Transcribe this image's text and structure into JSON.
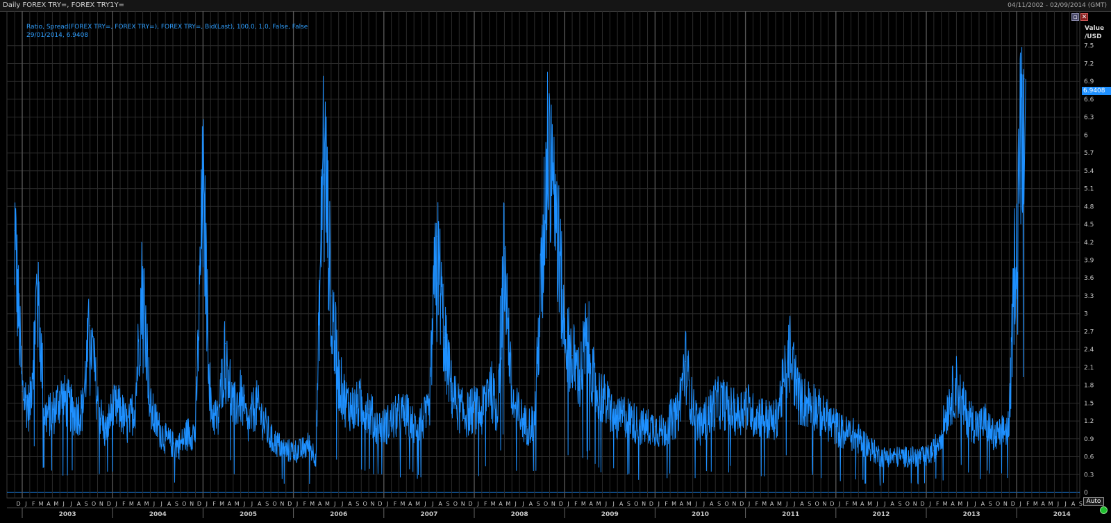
{
  "header": {
    "title": "Daily FOREX TRY=, FOREX TRY1Y=",
    "date_range": "04/11/2002 - 02/09/2014 (GMT)"
  },
  "legend": {
    "line1": "Ratio, Spread(FOREX TRY=, FOREX TRY=), FOREX TRY=, Bid(Last),  100.0, 1.0, False, False",
    "line2": "29/01/2014, 6.9408"
  },
  "axis": {
    "y_unit_line1": "Value",
    "y_unit_line2": "/USD",
    "last_value_tag": "6.9408",
    "auto_label": "Auto"
  },
  "buttons": {
    "restore_icon": "restore-icon",
    "close_icon": "close-icon"
  },
  "colors": {
    "series": "#1e90ff",
    "background": "#000000",
    "grid": "#2c2c2c",
    "text": "#c8c8c8"
  },
  "chart_data": {
    "type": "line",
    "title": "Daily FOREX TRY=, FOREX TRY1Y=",
    "ylabel": "Value /USD",
    "ylim": [
      0,
      7.8
    ],
    "yticks": [
      0,
      0.3,
      0.6,
      0.9,
      1.2,
      1.5,
      1.8,
      2.1,
      2.4,
      2.7,
      3,
      3.3,
      3.6,
      3.9,
      4.2,
      4.5,
      4.8,
      5.1,
      5.4,
      5.7,
      6,
      6.3,
      6.6,
      6.9,
      7.2,
      7.5
    ],
    "ytick_labels": [
      "0",
      "0.3",
      "0.6",
      "0.9",
      "1.2",
      "1.5",
      "1.8",
      "2.1",
      "2.4",
      "2.7",
      "3",
      "3.3",
      "3.6",
      "3.9",
      "4.2",
      "4.5",
      "4.8",
      "5.1",
      "5.4",
      "5.7",
      "6",
      "6.3",
      "6.6",
      "6.9",
      "7.2",
      "7.5"
    ],
    "years": [
      "2003",
      "2004",
      "2005",
      "2006",
      "2007",
      "2008",
      "2009",
      "2010",
      "2011",
      "2012",
      "2013",
      "2014"
    ],
    "month_letters": [
      "J",
      "F",
      "M",
      "A",
      "M",
      "J",
      "J",
      "A",
      "S",
      "O",
      "N",
      "D"
    ],
    "leading_month_letter": "D",
    "trailing_month_letters": [
      "J",
      "F",
      "M",
      "A",
      "M",
      "J",
      "J",
      "A",
      "S"
    ],
    "grid": true,
    "series": [
      {
        "name": "Ratio, Spread(FOREX TRY=, FOREX TRY=), FOREX TRY=, Bid(Last)",
        "x": [
          "2002-12",
          "2003-01",
          "2003-02",
          "2003-03",
          "2003-04",
          "2003-05",
          "2003-06",
          "2003-07",
          "2003-08",
          "2003-09",
          "2003-10",
          "2003-11",
          "2003-12",
          "2004-01",
          "2004-02",
          "2004-03",
          "2004-04",
          "2004-05",
          "2004-06",
          "2004-07",
          "2004-08",
          "2004-09",
          "2004-10",
          "2004-11",
          "2004-12",
          "2005-01",
          "2005-02",
          "2005-03",
          "2005-04",
          "2005-05",
          "2005-06",
          "2005-07",
          "2005-08",
          "2005-09",
          "2005-10",
          "2005-11",
          "2005-12",
          "2006-01",
          "2006-02",
          "2006-03",
          "2006-04",
          "2006-05",
          "2006-06",
          "2006-07",
          "2006-08",
          "2006-09",
          "2006-10",
          "2006-11",
          "2006-12",
          "2007-01",
          "2007-02",
          "2007-03",
          "2007-04",
          "2007-05",
          "2007-06",
          "2007-07",
          "2007-08",
          "2007-09",
          "2007-10",
          "2007-11",
          "2007-12",
          "2008-01",
          "2008-02",
          "2008-03",
          "2008-04",
          "2008-05",
          "2008-06",
          "2008-07",
          "2008-08",
          "2008-09",
          "2008-10",
          "2008-11",
          "2008-12",
          "2009-01",
          "2009-02",
          "2009-03",
          "2009-04",
          "2009-05",
          "2009-06",
          "2009-07",
          "2009-08",
          "2009-09",
          "2009-10",
          "2009-11",
          "2009-12",
          "2010-01",
          "2010-02",
          "2010-03",
          "2010-04",
          "2010-05",
          "2010-06",
          "2010-07",
          "2010-08",
          "2010-09",
          "2010-10",
          "2010-11",
          "2010-12",
          "2011-01",
          "2011-02",
          "2011-03",
          "2011-04",
          "2011-05",
          "2011-06",
          "2011-07",
          "2011-08",
          "2011-09",
          "2011-10",
          "2011-11",
          "2011-12",
          "2012-01",
          "2012-02",
          "2012-03",
          "2012-04",
          "2012-05",
          "2012-06",
          "2012-07",
          "2012-08",
          "2012-09",
          "2012-10",
          "2012-11",
          "2012-12",
          "2013-01",
          "2013-02",
          "2013-03",
          "2013-04",
          "2013-05",
          "2013-06",
          "2013-07",
          "2013-08",
          "2013-09",
          "2013-10",
          "2013-11",
          "2013-12",
          "2014-01",
          "2014-02"
        ],
        "values": [
          4.4,
          1.7,
          1.4,
          3.5,
          1.3,
          1.3,
          1.6,
          1.5,
          1.3,
          1.4,
          2.8,
          1.5,
          1.0,
          1.4,
          1.4,
          1.1,
          1.5,
          3.7,
          1.4,
          1.1,
          0.9,
          0.8,
          0.8,
          1.0,
          1.0,
          5.2,
          1.4,
          1.2,
          2.5,
          1.4,
          1.6,
          1.1,
          1.5,
          1.2,
          0.9,
          0.8,
          0.7,
          0.7,
          0.7,
          0.8,
          0.6,
          6.1,
          3.3,
          1.9,
          1.5,
          1.4,
          1.5,
          1.4,
          1.1,
          1.1,
          1.2,
          1.3,
          1.3,
          1.1,
          1.2,
          1.3,
          4.3,
          2.6,
          1.7,
          1.4,
          1.3,
          1.4,
          1.3,
          1.9,
          1.3,
          4.1,
          1.5,
          1.3,
          1.1,
          1.2,
          3.8,
          6.6,
          4.5,
          2.6,
          2.3,
          1.9,
          2.7,
          1.7,
          1.6,
          1.4,
          1.2,
          1.3,
          1.2,
          1.1,
          1.1,
          1.1,
          1.0,
          1.2,
          1.3,
          2.2,
          1.4,
          1.1,
          1.3,
          1.5,
          1.5,
          1.4,
          1.3,
          1.5,
          1.3,
          1.3,
          1.2,
          1.2,
          1.8,
          2.4,
          1.6,
          1.5,
          1.5,
          1.3,
          1.2,
          1.1,
          1.0,
          1.0,
          0.9,
          0.8,
          0.7,
          0.6,
          0.6,
          0.6,
          0.6,
          0.6,
          0.6,
          0.6,
          0.7,
          1.0,
          1.5,
          1.8,
          1.4,
          1.2,
          1.1,
          1.2,
          0.9,
          1.0,
          1.1,
          4.8,
          6.9408
        ]
      }
    ],
    "last_point": {
      "date": "29/01/2014",
      "value": 6.9408
    }
  }
}
